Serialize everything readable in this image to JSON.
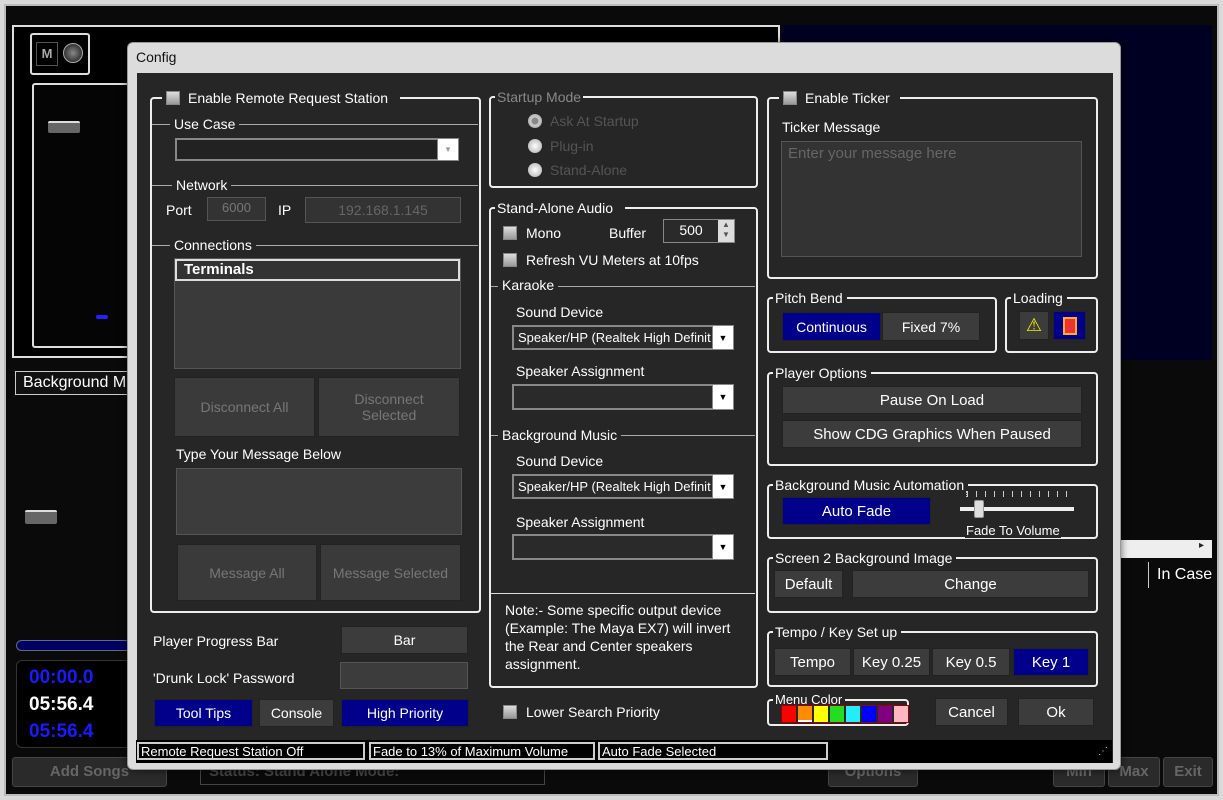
{
  "background_app": {
    "header": "Background M",
    "mute_label": "M",
    "time_elapsed": "00:00.0",
    "time_total": "05:56.4",
    "time_remaining": "05:56.4",
    "add_songs": "Add Songs",
    "status": "Status: Stand Alone Mode:",
    "options": "Options",
    "min": "Min",
    "max": "Max",
    "exit": "Exit",
    "column_in_case": "In Case"
  },
  "dialog": {
    "title": "Config",
    "remote": {
      "enable_label": "Enable Remote Request Station",
      "enabled": false,
      "use_case_label": "Use Case",
      "use_case_value": "",
      "network_label": "Network",
      "port_label": "Port",
      "port_value": "6000",
      "ip_label": "IP",
      "ip_value": "192.168.1.145",
      "connections_label": "Connections",
      "terminals_header": "Terminals",
      "disconnect_all": "Disconnect All",
      "disconnect_selected": "Disconnect Selected",
      "message_label": "Type Your Message Below",
      "message_all": "Message All",
      "message_selected": "Message Selected"
    },
    "player_progress_label": "Player Progress Bar",
    "player_progress_value": "Bar",
    "drunk_lock_label": "'Drunk Lock' Password",
    "drunk_lock_value": "",
    "tool_tips": "Tool Tips",
    "console": "Console",
    "high_priority": "High Priority",
    "startup_mode": {
      "label": "Startup Mode",
      "options": [
        "Ask At Startup",
        "Plug-in",
        "Stand-Alone"
      ],
      "selected": "Ask At Startup"
    },
    "standalone_audio": {
      "label": "Stand-Alone Audio",
      "mono_label": "Mono",
      "mono": false,
      "buffer_label": "Buffer",
      "buffer_value": "500",
      "refresh_label": "Refresh VU Meters at 10fps",
      "refresh": false,
      "karaoke_label": "Karaoke",
      "karaoke_sound_device_label": "Sound Device",
      "karaoke_sound_device": "Speaker/HP (Realtek High Definit",
      "karaoke_speaker_label": "Speaker Assignment",
      "karaoke_speaker": "",
      "bgm_label": "Background Music",
      "bgm_sound_device_label": "Sound Device",
      "bgm_sound_device": "Speaker/HP (Realtek High Definit",
      "bgm_speaker_label": "Speaker Assignment",
      "bgm_speaker": "",
      "note": "Note:- Some specific output device (Example: The Maya EX7) will invert the Rear and Center speakers assignment."
    },
    "lower_search_label": "Lower Search Priority",
    "ticker": {
      "enable_label": "Enable Ticker",
      "message_label": "Ticker Message",
      "message_placeholder": "Enter your message here"
    },
    "pitch_bend": {
      "label": "Pitch Bend",
      "continuous": "Continuous",
      "fixed": "Fixed 7%",
      "selected": "Continuous"
    },
    "loading": {
      "label": "Loading",
      "icons": [
        "warning-icon",
        "stop-icon"
      ]
    },
    "player_options": {
      "label": "Player Options",
      "pause_on_load": "Pause On Load",
      "show_cdg": "Show CDG Graphics When Paused"
    },
    "bgm_automation": {
      "label": "Background Music Automation",
      "auto_fade": "Auto Fade",
      "fade_label": "Fade To Volume",
      "fade_volume_percent": 13
    },
    "screen2": {
      "label": "Screen 2 Background Image",
      "default": "Default",
      "change": "Change"
    },
    "tempo_key": {
      "label": "Tempo / Key Set up",
      "buttons": [
        "Tempo",
        "Key 0.25",
        "Key 0.5",
        "Key 1"
      ],
      "selected": "Key 1"
    },
    "menu_color": {
      "label": "Menu Color",
      "colors": [
        "#ff0000",
        "#ff8c00",
        "#ffff00",
        "#22dd22",
        "#22eeff",
        "#0000ff",
        "#800080",
        "#ffb6c1"
      ],
      "selected": "#ff8c00"
    },
    "cancel": "Cancel",
    "ok": "Ok",
    "statusbar": [
      "Remote Request Station Off",
      "Fade to 13% of Maximum Volume",
      "Auto Fade Selected"
    ]
  },
  "colors": {
    "accent_blue": "#00008a",
    "panel": "#262626"
  }
}
